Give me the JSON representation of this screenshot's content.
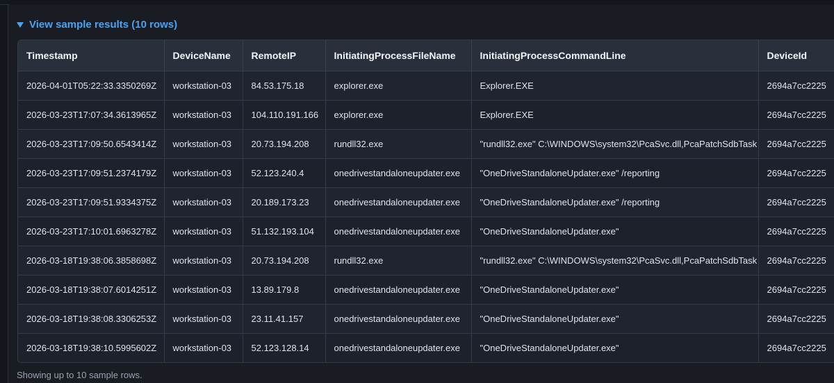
{
  "results_toggle": {
    "label": "View sample results (10 rows)"
  },
  "table": {
    "columns": [
      "Timestamp",
      "DeviceName",
      "RemoteIP",
      "InitiatingProcessFileName",
      "InitiatingProcessCommandLine",
      "DeviceId"
    ],
    "rows": [
      [
        "2026-04-01T05:22:33.3350269Z",
        "workstation-03",
        "84.53.175.18",
        "explorer.exe",
        "Explorer.EXE",
        "2694a7cc2225"
      ],
      [
        "2026-03-23T17:07:34.3613965Z",
        "workstation-03",
        "104.110.191.166",
        "explorer.exe",
        "Explorer.EXE",
        "2694a7cc2225"
      ],
      [
        "2026-03-23T17:09:50.6543414Z",
        "workstation-03",
        "20.73.194.208",
        "rundll32.exe",
        "\"rundll32.exe\" C:\\WINDOWS\\system32\\PcaSvc.dll,PcaPatchSdbTask",
        "2694a7cc2225"
      ],
      [
        "2026-03-23T17:09:51.2374179Z",
        "workstation-03",
        "52.123.240.4",
        "onedrivestandaloneupdater.exe",
        "\"OneDriveStandaloneUpdater.exe\" /reporting",
        "2694a7cc2225"
      ],
      [
        "2026-03-23T17:09:51.9334375Z",
        "workstation-03",
        "20.189.173.23",
        "onedrivestandaloneupdater.exe",
        "\"OneDriveStandaloneUpdater.exe\" /reporting",
        "2694a7cc2225"
      ],
      [
        "2026-03-23T17:10:01.6963278Z",
        "workstation-03",
        "51.132.193.104",
        "onedrivestandaloneupdater.exe",
        "\"OneDriveStandaloneUpdater.exe\"",
        "2694a7cc2225"
      ],
      [
        "2026-03-18T19:38:06.3858698Z",
        "workstation-03",
        "20.73.194.208",
        "rundll32.exe",
        "\"rundll32.exe\" C:\\WINDOWS\\system32\\PcaSvc.dll,PcaPatchSdbTask",
        "2694a7cc2225"
      ],
      [
        "2026-03-18T19:38:07.6014251Z",
        "workstation-03",
        "13.89.179.8",
        "onedrivestandaloneupdater.exe",
        "\"OneDriveStandaloneUpdater.exe\"",
        "2694a7cc2225"
      ],
      [
        "2026-03-18T19:38:08.3306253Z",
        "workstation-03",
        "23.11.41.157",
        "onedrivestandaloneupdater.exe",
        "\"OneDriveStandaloneUpdater.exe\"",
        "2694a7cc2225"
      ],
      [
        "2026-03-18T19:38:10.5995602Z",
        "workstation-03",
        "52.123.128.14",
        "onedrivestandaloneupdater.exe",
        "\"OneDriveStandaloneUpdater.exe\"",
        "2694a7cc2225"
      ]
    ]
  },
  "footer": {
    "note": "Showing up to 10 sample rows."
  },
  "icons": {
    "toggle": "caret-down-icon"
  },
  "colors": {
    "accent": "#4aa3f0",
    "background": "#14161d",
    "table_header": "#2a2f3c"
  }
}
